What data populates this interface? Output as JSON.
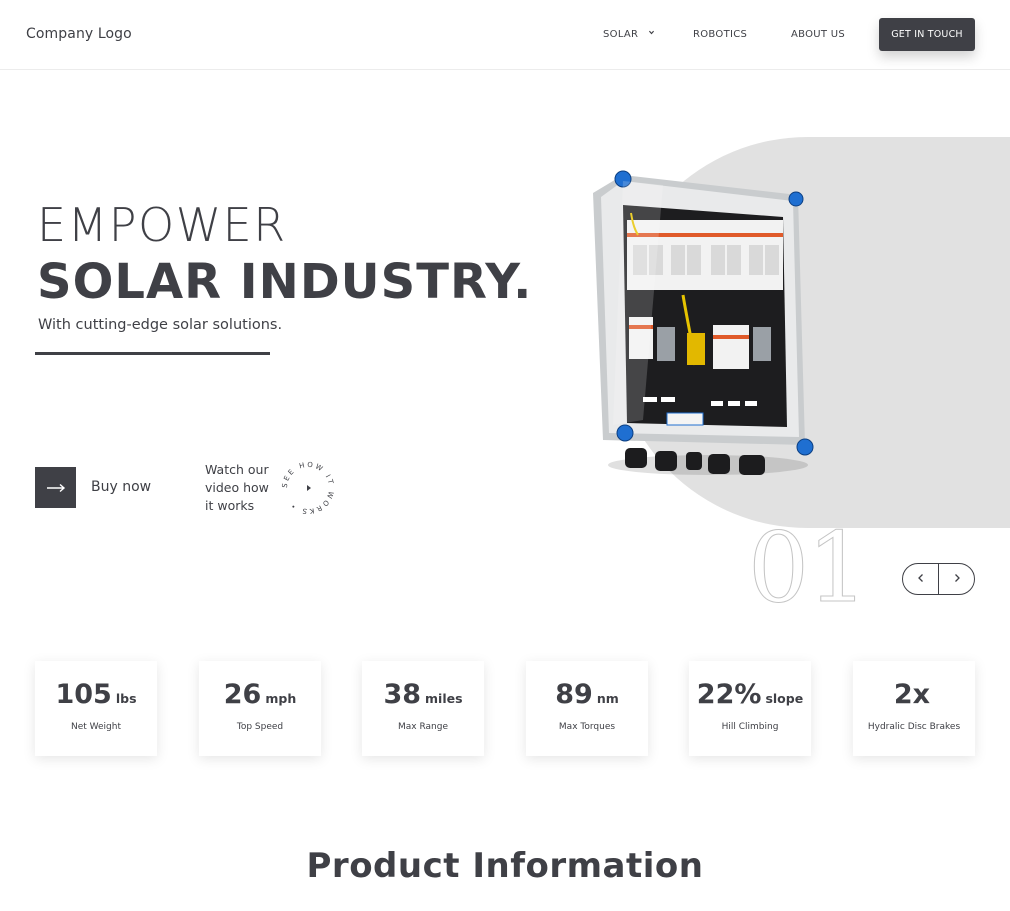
{
  "header": {
    "logo": "Company Logo",
    "nav": [
      {
        "label": "SOLAR",
        "has_dropdown": true
      },
      {
        "label": "ROBOTICS"
      },
      {
        "label": "ABOUT US"
      }
    ],
    "cta_label": "GET IN TOUCH"
  },
  "hero": {
    "line1": "EMPOWER",
    "line2": "SOLAR INDUSTRY.",
    "subtitle": "With cutting-edge solar solutions.",
    "buy_label": "Buy now",
    "watch_lines": [
      "Watch our",
      "video how",
      "it works"
    ],
    "circle_text": "SEE HOW IT WORKS • ",
    "slide_number": "01"
  },
  "stats": [
    {
      "value": "105",
      "unit": "lbs",
      "label": "Net Weight"
    },
    {
      "value": "26",
      "unit": "mph",
      "label": "Top Speed"
    },
    {
      "value": "38",
      "unit": "miles",
      "label": "Max Range"
    },
    {
      "value": "89",
      "unit": "nm",
      "label": "Max Torques"
    },
    {
      "value": "22%",
      "unit": "slope",
      "label": "Hill Climbing"
    },
    {
      "value": "2x",
      "unit": "",
      "label": "Hydralic Disc Brakes"
    }
  ],
  "product_info_title": "Product Information",
  "colors": {
    "primary": "#3f4046",
    "hero_shape": "#e1e1e1",
    "accent_blue": "#1f6fd1"
  }
}
